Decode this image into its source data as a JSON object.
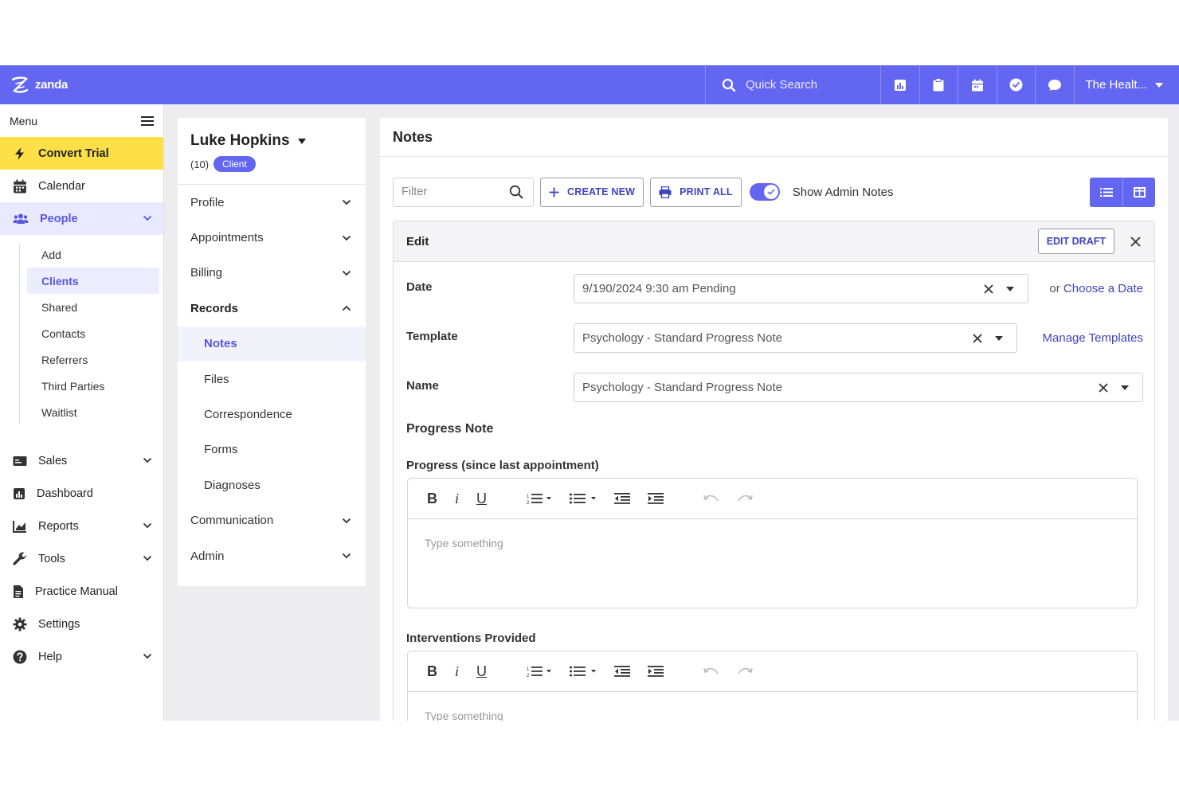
{
  "app": {
    "logo_text": "zanda",
    "quick_search": "Quick Search",
    "account": "The Healt..."
  },
  "colors": {
    "brand": "#6366f1",
    "convert_highlight": "#fde047",
    "link": "#3f44c0"
  },
  "icons": [
    "search-icon",
    "chart-icon",
    "clipboard-icon",
    "calendar-icon",
    "check-circle-icon",
    "chat-icon",
    "hamburger-icon",
    "bolt-icon",
    "users-icon",
    "cash-icon",
    "dashboard-icon",
    "reports-icon",
    "wrench-icon",
    "document-icon",
    "gear-icon",
    "help-icon",
    "chevron-down-icon",
    "chevron-up-icon",
    "plus-icon",
    "printer-icon",
    "list-view-icon",
    "grid-view-icon",
    "close-icon"
  ],
  "sidebar": {
    "menu_label": "Menu",
    "convert_trial": "Convert Trial",
    "calendar": "Calendar",
    "people": "People",
    "people_sub": [
      "Add",
      "Clients",
      "Shared",
      "Contacts",
      "Referrers",
      "Third Parties",
      "Waitlist"
    ],
    "items_after": [
      "Sales",
      "Dashboard",
      "Reports",
      "Tools",
      "Practice Manual",
      "Settings",
      "Help"
    ]
  },
  "client": {
    "name": "Luke Hopkins",
    "count": "(10)",
    "badge": "Client"
  },
  "records_nav": {
    "profile": "Profile",
    "appointments": "Appointments",
    "billing": "Billing",
    "records": "Records",
    "records_sub": [
      "Notes",
      "Files",
      "Correspondence",
      "Forms",
      "Diagnoses"
    ],
    "communication": "Communication",
    "admin": "Admin"
  },
  "notes": {
    "title": "Notes",
    "filter_placeholder": "Filter",
    "create_new": "CREATE NEW",
    "print_all": "PRINT ALL",
    "show_admin_notes": "Show Admin Notes",
    "show_admin_notes_on": true,
    "edit": {
      "title": "Edit",
      "edit_draft": "EDIT DRAFT",
      "date_label": "Date",
      "date_value": "9/190/2024 9:30 am Pending",
      "or": "or",
      "choose_date": "Choose a Date",
      "template_label": "Template",
      "template_value": "Psychology - Standard Progress Note",
      "manage_templates": "Manage Templates",
      "name_label": "Name",
      "name_value": "Psychology - Standard Progress Note",
      "section_title": "Progress Note",
      "progress_label": "Progress (since last appointment)",
      "interventions_label": "Interventions Provided",
      "editor_placeholder": "Type something"
    }
  }
}
